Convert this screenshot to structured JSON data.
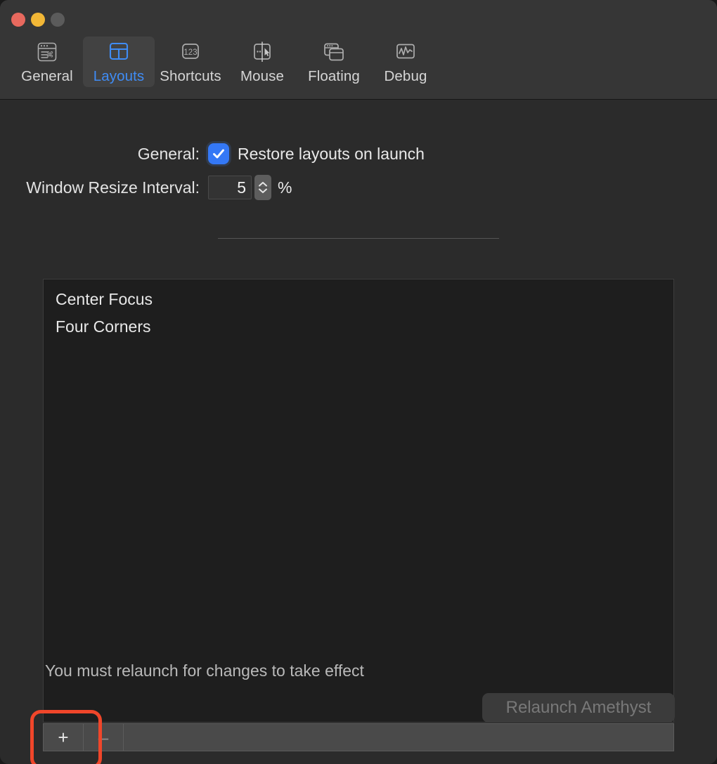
{
  "window": {
    "traffic_lights": [
      {
        "name": "close",
        "color": "#e8695e"
      },
      {
        "name": "minimize",
        "color": "#f2b736"
      },
      {
        "name": "zoom",
        "color": "#5b5b5b"
      }
    ]
  },
  "toolbar": {
    "items": [
      {
        "label": "General",
        "icon": "general-window-icon",
        "selected": false
      },
      {
        "label": "Layouts",
        "icon": "layouts-grid-icon",
        "selected": true
      },
      {
        "label": "Shortcuts",
        "icon": "shortcuts-123-icon",
        "selected": false
      },
      {
        "label": "Mouse",
        "icon": "mouse-cursor-icon",
        "selected": false
      },
      {
        "label": "Floating",
        "icon": "floating-windows-icon",
        "selected": false
      },
      {
        "label": "Debug",
        "icon": "debug-waveform-icon",
        "selected": false
      }
    ],
    "selected_accent": "#3f8cf5"
  },
  "settings": {
    "general_label": "General:",
    "restore_layouts": {
      "label": "Restore layouts on launch",
      "checked": true,
      "checkbox_color": "#3478f6"
    },
    "resize_interval": {
      "label": "Window Resize Interval:",
      "value": "5",
      "unit": "%"
    }
  },
  "layouts_list": {
    "items": [
      {
        "label": "Center Focus"
      },
      {
        "label": "Four Corners"
      }
    ],
    "toolbar": {
      "add_label": "+",
      "remove_label": "–",
      "remove_disabled": true
    }
  },
  "footer": {
    "relaunch_hint": "You must relaunch for changes to take effect",
    "relaunch_button": "Relaunch Amethyst",
    "relaunch_disabled": true
  },
  "annotation": {
    "color": "#f0462a",
    "target": "add-layout-button"
  }
}
